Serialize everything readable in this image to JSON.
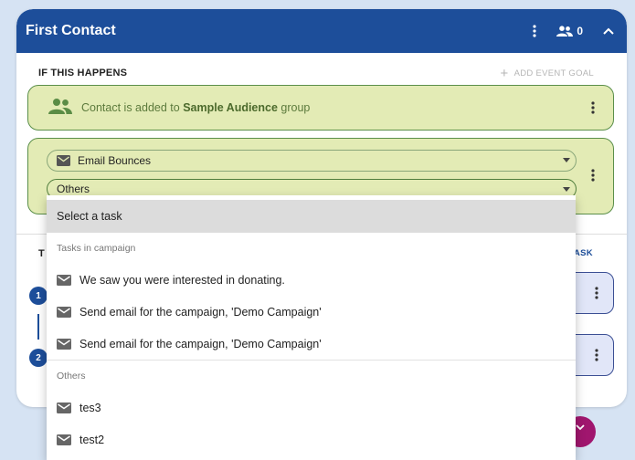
{
  "card": {
    "title": "First Contact",
    "participant_count": "0"
  },
  "trigger_section": {
    "title": "IF THIS HAPPENS",
    "add_goal_label": "ADD EVENT GOAL"
  },
  "trigger": {
    "prefix": "Contact is added to ",
    "audience": "Sample Audience",
    "suffix": " group"
  },
  "event": {
    "type_value": "Email Bounces",
    "task_value": "Others"
  },
  "then_section": {
    "title_visible": "T",
    "add_task_visible": "ASK"
  },
  "steps": [
    "1",
    "2"
  ],
  "dropdown": {
    "placeholder": "Select a task",
    "groups": [
      {
        "label": "Tasks in campaign",
        "items": [
          "We saw you were interested in donating.",
          "Send email for the campaign, 'Demo Campaign'",
          "Send email for the campaign, 'Demo Campaign'"
        ]
      },
      {
        "label": "Others",
        "items": [
          "tes3",
          "test2"
        ]
      }
    ]
  },
  "colors": {
    "header": "#1d4e9a",
    "trigger_bg": "#e3ebb5",
    "trigger_border": "#5b8f4a",
    "task_card_bg": "#e1e6f8",
    "fab": "#a0166e"
  }
}
